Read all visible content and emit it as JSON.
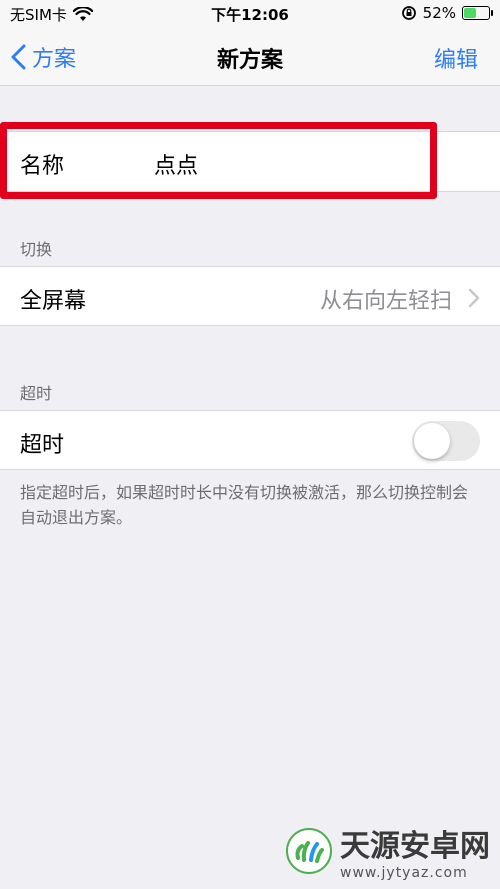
{
  "status_bar": {
    "carrier": "无SIM卡",
    "time": "下午12:06",
    "battery_percent": "52%",
    "battery_level": 0.52
  },
  "nav": {
    "back_label": "方案",
    "title": "新方案",
    "edit_label": "编辑"
  },
  "name_row": {
    "label": "名称",
    "value": "点点"
  },
  "switch_section": {
    "header": "切换",
    "row_label": "全屏幕",
    "row_value": "从右向左轻扫"
  },
  "timeout_section": {
    "header": "超时",
    "row_label": "超时",
    "toggle_on": false,
    "footer": "指定超时后，如果超时时长中没有切换被激活，那么切换控制会自动退出方案。"
  },
  "watermark": {
    "main": "天源安卓网",
    "sub": "www.jytyaz.com"
  },
  "colors": {
    "accent": "#2e7cf6",
    "highlight": "#e0001b",
    "background": "#efeff4"
  }
}
